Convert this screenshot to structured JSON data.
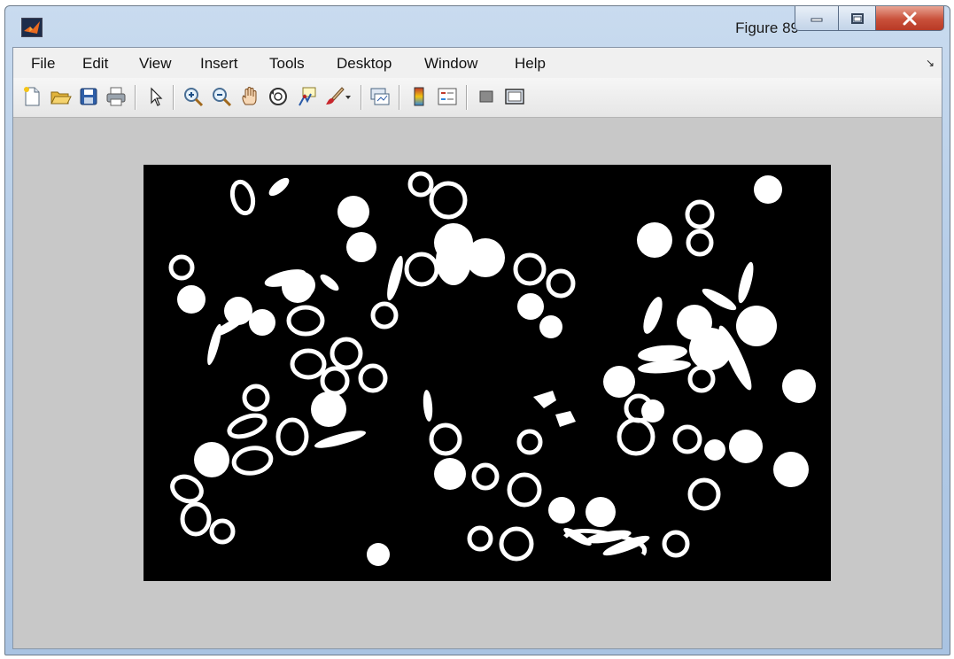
{
  "window": {
    "title": "Figure 89",
    "icon": "matlab-icon"
  },
  "menubar": {
    "items": [
      {
        "id": "file",
        "label": "File"
      },
      {
        "id": "edit",
        "label": "Edit"
      },
      {
        "id": "view",
        "label": "View"
      },
      {
        "id": "insert",
        "label": "Insert"
      },
      {
        "id": "tools",
        "label": "Tools"
      },
      {
        "id": "desktop",
        "label": "Desktop"
      },
      {
        "id": "window",
        "label": "Window"
      },
      {
        "id": "help",
        "label": "Help"
      }
    ]
  },
  "toolbar": {
    "buttons": [
      "new-figure-icon",
      "open-file-icon",
      "save-icon",
      "print-icon",
      "edit-plot-icon",
      "zoom-in-icon",
      "zoom-out-icon",
      "pan-icon",
      "rotate-3d-icon",
      "data-cursor-icon",
      "brush-icon",
      "link-plot-icon",
      "colorbar-icon",
      "legend-icon",
      "hide-plot-tools-icon",
      "show-plot-tools-icon"
    ]
  },
  "colors": {
    "figure_background": "#c8c8c8",
    "image_background": "#000000",
    "blob_color": "#ffffff",
    "close_button": "#c9503a"
  },
  "image": {
    "description_kind": "binary-segmentation"
  }
}
